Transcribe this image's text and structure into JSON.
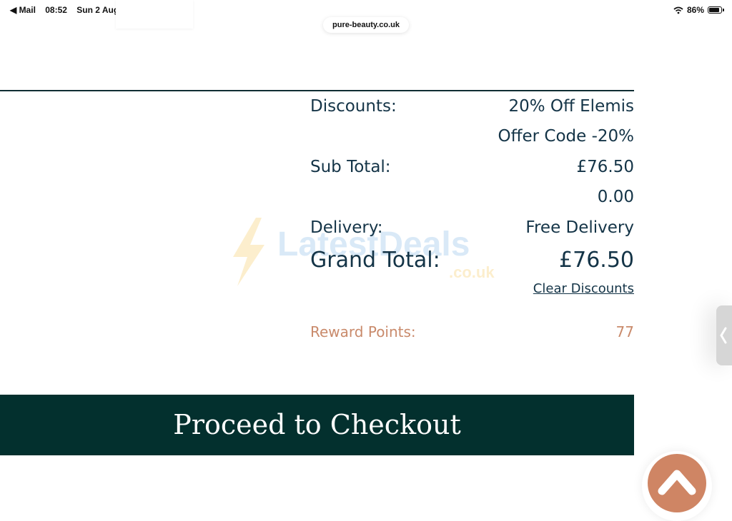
{
  "status_bar": {
    "back_app": "◀ Mail",
    "time": "08:52",
    "date": "Sun 2 Aug",
    "battery": "86%"
  },
  "browser": {
    "url": "pure-beauty.co.uk"
  },
  "summary": {
    "discounts_label": "Discounts:",
    "discount_1": "20% Off Elemis",
    "discount_2": "Offer Code -20%",
    "subtotal_label": "Sub Total:",
    "subtotal_value": "£76.50",
    "extra_value": "0.00",
    "delivery_label": "Delivery:",
    "delivery_value": "Free Delivery",
    "grand_label": "Grand Total:",
    "grand_value": "£76.50",
    "clear_discounts": "Clear Discounts",
    "reward_label": "Reward Points:",
    "reward_value": "77"
  },
  "checkout_label": "Proceed to Checkout",
  "watermark": {
    "text": "LatestDeals",
    "sub": ".co.uk"
  },
  "colors": {
    "text_dark": "#143447",
    "checkout_bg": "#03302e",
    "reward": "#c98a6b",
    "scroll_button": "#cf8564"
  },
  "icons": {
    "wifi": "wifi-icon",
    "battery": "battery-icon",
    "scroll_top": "chevron-up-icon",
    "side_tab": "chevron-left-icon"
  }
}
